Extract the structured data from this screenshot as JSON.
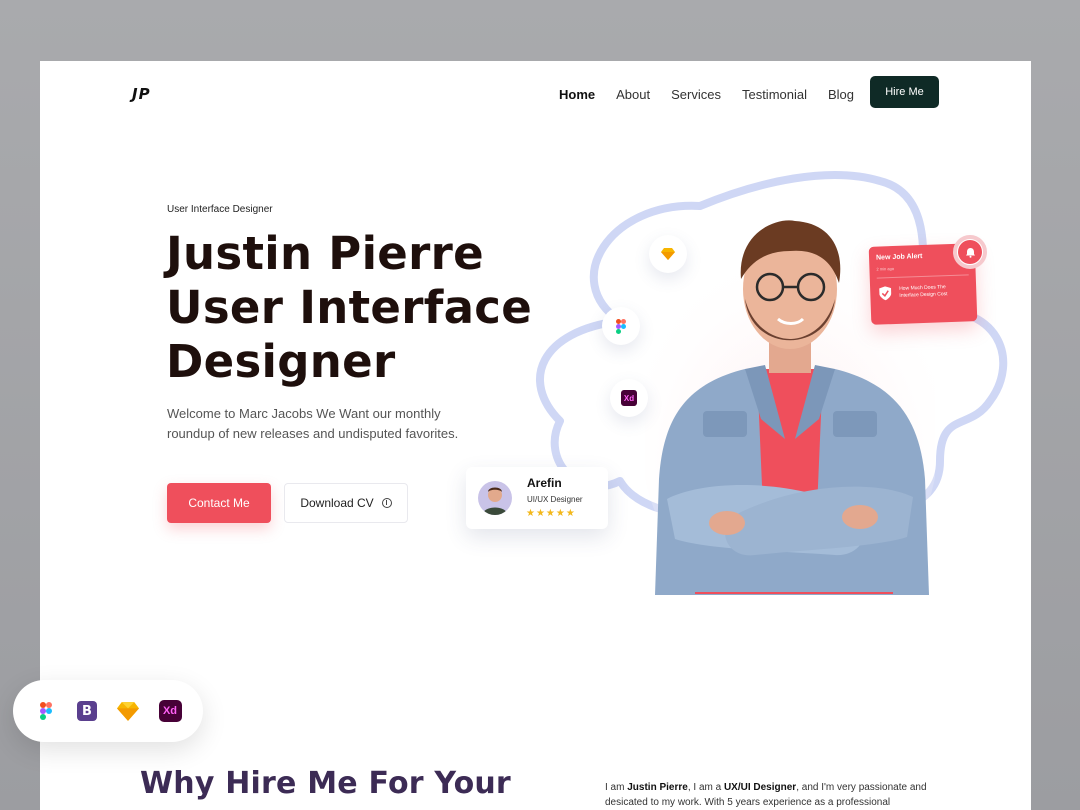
{
  "header": {
    "logo": "JP",
    "nav": [
      "Home",
      "About",
      "Services",
      "Testimonial",
      "Blog"
    ],
    "active_nav": "Home",
    "cta": "Hire Me"
  },
  "hero": {
    "eyebrow": "User Interface Designer",
    "headline_lines": [
      "Justin Pierre",
      "User Interface",
      "Designer"
    ],
    "description_lines": [
      "Welcome to Marc Jacobs We Want our monthly",
      "roundup of new releases and undisputed favorites."
    ],
    "primary_button": "Contact Me",
    "secondary_button": "Download CV"
  },
  "alert_card": {
    "title": "New Job Alert",
    "subtitle": "2 min ago",
    "message_lines": [
      "How Much Does The",
      "Interface Design Cost"
    ]
  },
  "profile_card": {
    "name": "Arefin",
    "role": "UI/UX Designer",
    "rating": 4.5,
    "stars": "★★★★★"
  },
  "floating_icons": [
    "sketch-icon",
    "figma-icon",
    "xd-icon"
  ],
  "tools": [
    "figma-icon",
    "bootstrap-icon",
    "sketch-icon",
    "xd-icon"
  ],
  "tool_labels": {
    "bootstrap": "B",
    "xd": "Xd"
  },
  "section": {
    "heading": "Why Hire Me For Your",
    "about_parts": [
      "I am ",
      "Justin Pierre",
      ", I am a ",
      "UX/UI Designer",
      ", and I'm very passionate and",
      "desicated to my work. With 5 years experience as a professional"
    ]
  },
  "colors": {
    "accent": "#ef4f5c",
    "dark_button": "#0f2a26",
    "heading": "#1e0f0c",
    "outline": "#c9d2f3"
  }
}
